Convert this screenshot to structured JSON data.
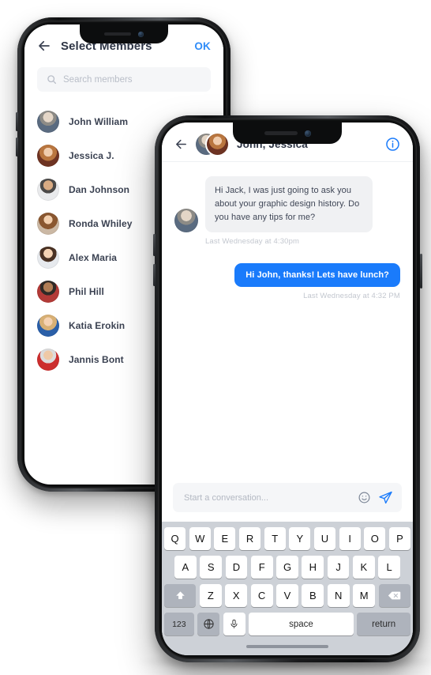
{
  "select_members_screen": {
    "header": {
      "back_icon": "arrow-left-icon",
      "title": "Select Members",
      "confirm_label": "OK"
    },
    "search": {
      "icon": "search-icon",
      "placeholder": "Search members",
      "value": ""
    },
    "members": [
      {
        "name": "John William",
        "avatar": "a1"
      },
      {
        "name": "Jessica J.",
        "avatar": "a2"
      },
      {
        "name": "Dan Johnson",
        "avatar": "a3"
      },
      {
        "name": "Ronda Whiley",
        "avatar": "a4"
      },
      {
        "name": "Alex Maria",
        "avatar": "a5"
      },
      {
        "name": "Phil Hill",
        "avatar": "a6"
      },
      {
        "name": "Katia Erokin",
        "avatar": "a7"
      },
      {
        "name": "Jannis Bont",
        "avatar": "a8"
      }
    ]
  },
  "chat_screen": {
    "header": {
      "back_icon": "arrow-left-icon",
      "title": "John, Jessica",
      "info_icon": "info-circle-icon"
    },
    "messages": [
      {
        "direction": "incoming",
        "text": "Hi Jack, I was just going to ask you about your graphic design history. Do you have any tips for me?",
        "timestamp": "Last Wednesday at 4:30pm"
      },
      {
        "direction": "outgoing",
        "text": "Hi John, thanks! Lets have lunch?",
        "timestamp": "Last Wednesday at 4:32 PM"
      }
    ],
    "composer": {
      "placeholder": "Start a conversation...",
      "value": "",
      "emoji_icon": "smiley-icon",
      "send_icon": "send-paper-plane-icon"
    }
  },
  "keyboard": {
    "row1": [
      "Q",
      "W",
      "E",
      "R",
      "T",
      "Y",
      "U",
      "I",
      "O",
      "P"
    ],
    "row2": [
      "A",
      "S",
      "D",
      "F",
      "G",
      "H",
      "J",
      "K",
      "L"
    ],
    "row3": [
      "Z",
      "X",
      "C",
      "V",
      "B",
      "N",
      "M"
    ],
    "shift_icon": "shift-up-arrow-icon",
    "backspace_icon": "backspace-delete-icon",
    "numbers_label": "123",
    "globe_icon": "globe-language-icon",
    "mic_icon": "microphone-icon",
    "space_label": "space",
    "return_label": "return"
  },
  "colors": {
    "accent_blue": "#1a7bfb",
    "ok_blue": "#2f8cf8",
    "bubble_in_bg": "#f0f1f3",
    "text_dark": "#2e3545",
    "timestamp_gray": "#c3c7cf",
    "keyboard_bg": "#cdd1d7",
    "key_dark": "#aeb3bc"
  }
}
